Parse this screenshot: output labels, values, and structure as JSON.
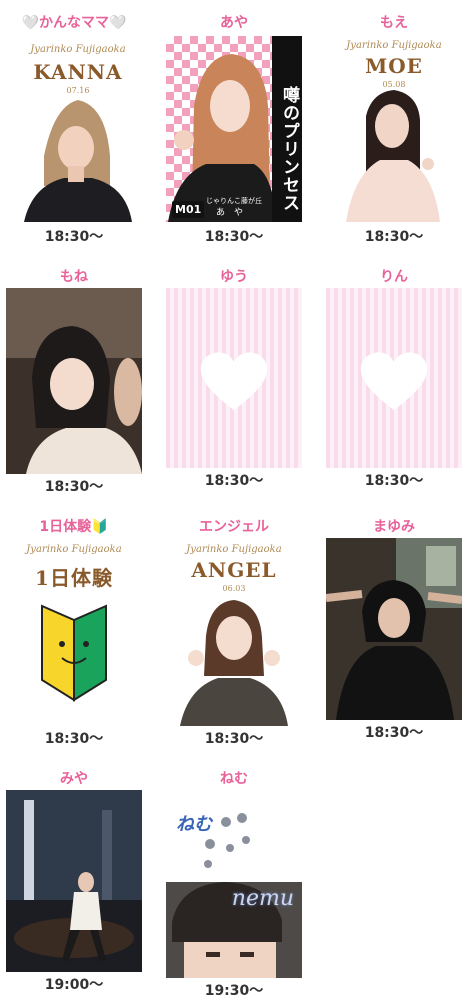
{
  "cast": [
    {
      "name": "🤍かんなママ🤍",
      "brand": "Jyarinko Fujigaoka",
      "card_name": "KANNA",
      "card_date": "07.16",
      "time": "18:30〜"
    },
    {
      "name": "あや",
      "banner": "噂のプリンセス",
      "tag_code": "M01",
      "tag_shop": "じゃりんこ藤が丘",
      "tag_name": "あ　や",
      "time": "18:30〜"
    },
    {
      "name": "もえ",
      "brand": "Jyarinko Fujigaoka",
      "card_name": "MOE",
      "card_date": "05.08",
      "time": "18:30〜"
    },
    {
      "name": "もね",
      "time": "18:30〜"
    },
    {
      "name": "ゆう",
      "time": "18:30〜"
    },
    {
      "name": "りん",
      "time": "18:30〜"
    },
    {
      "name": "1日体験🔰",
      "brand": "Jyarinko Fujigaoka",
      "card_name": "1日体験",
      "time": "18:30〜"
    },
    {
      "name": "エンジェル",
      "brand": "Jyarinko Fujigaoka",
      "card_name": "ANGEL",
      "card_date": "06.03",
      "time": "18:30〜"
    },
    {
      "name": "まゆみ",
      "time": "18:30〜"
    },
    {
      "name": "みや",
      "time": "19:00〜"
    },
    {
      "name": "ねむ",
      "stamp": "ねむ",
      "script": "nemu",
      "time": "19:30〜"
    }
  ],
  "colors": {
    "name_pink": "#e8629a",
    "time_text": "#333333",
    "card_brown": "#8a5a2b"
  }
}
